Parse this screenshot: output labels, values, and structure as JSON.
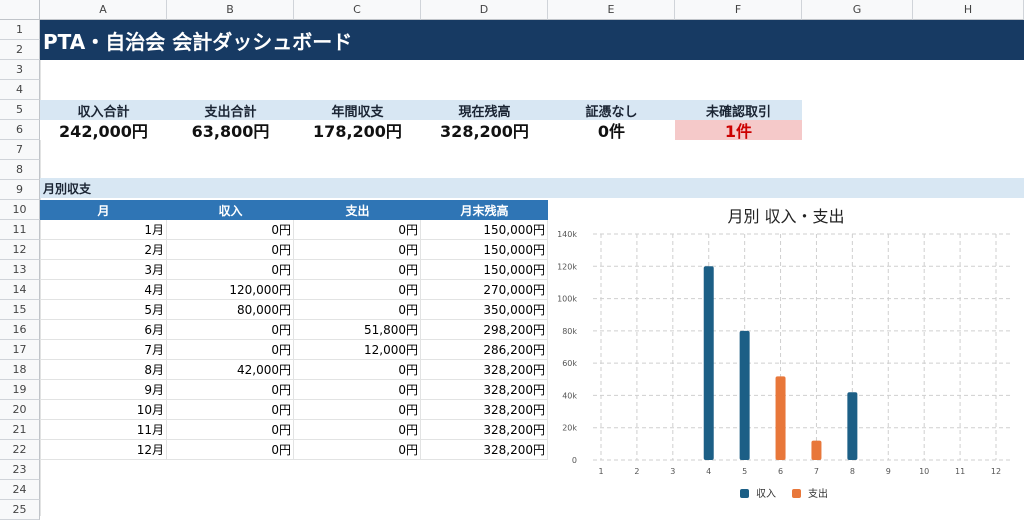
{
  "columns": [
    "A",
    "B",
    "C",
    "D",
    "E",
    "F",
    "G",
    "H"
  ],
  "rows": [
    "1",
    "2",
    "3",
    "4",
    "5",
    "6",
    "7",
    "8",
    "9",
    "10",
    "11",
    "12",
    "13",
    "14",
    "15",
    "16",
    "17",
    "18",
    "19",
    "20",
    "21",
    "22",
    "23",
    "24",
    "25"
  ],
  "title": "PTA・自治会 会計ダッシュボード",
  "kpis": [
    {
      "label": "収入合計",
      "value": "242,000円"
    },
    {
      "label": "支出合計",
      "value": "63,800円"
    },
    {
      "label": "年間収支",
      "value": "178,200円"
    },
    {
      "label": "現在残高",
      "value": "328,200円"
    },
    {
      "label": "証憑なし",
      "value": "0件"
    },
    {
      "label": "未確認取引",
      "value": "1件"
    }
  ],
  "section_title": "月別収支",
  "table": {
    "headers": [
      "月",
      "収入",
      "支出",
      "月末残高"
    ],
    "rows": [
      [
        "1月",
        "0円",
        "0円",
        "150,000円"
      ],
      [
        "2月",
        "0円",
        "0円",
        "150,000円"
      ],
      [
        "3月",
        "0円",
        "0円",
        "150,000円"
      ],
      [
        "4月",
        "120,000円",
        "0円",
        "270,000円"
      ],
      [
        "5月",
        "80,000円",
        "0円",
        "350,000円"
      ],
      [
        "6月",
        "0円",
        "51,800円",
        "298,200円"
      ],
      [
        "7月",
        "0円",
        "12,000円",
        "286,200円"
      ],
      [
        "8月",
        "42,000円",
        "0円",
        "328,200円"
      ],
      [
        "9月",
        "0円",
        "0円",
        "328,200円"
      ],
      [
        "10月",
        "0円",
        "0円",
        "328,200円"
      ],
      [
        "11月",
        "0円",
        "0円",
        "328,200円"
      ],
      [
        "12月",
        "0円",
        "0円",
        "328,200円"
      ]
    ]
  },
  "colors": {
    "title_bg": "#173a63",
    "header_bg": "#2f75b5",
    "label_bg": "#d8e7f3",
    "warn_bg": "#f5c9c9",
    "warn_text": "#cc0000",
    "income": "#1c5f86",
    "expense": "#e8773a"
  },
  "chart_data": {
    "type": "bar",
    "title": "月別 収入・支出",
    "categories": [
      "1",
      "2",
      "3",
      "4",
      "5",
      "6",
      "7",
      "8",
      "9",
      "10",
      "11",
      "12"
    ],
    "series": [
      {
        "name": "収入",
        "values": [
          0,
          0,
          0,
          120000,
          80000,
          0,
          0,
          42000,
          0,
          0,
          0,
          0
        ]
      },
      {
        "name": "支出",
        "values": [
          0,
          0,
          0,
          0,
          0,
          51800,
          12000,
          0,
          0,
          0,
          0,
          0
        ]
      }
    ],
    "ylim": [
      0,
      140000
    ],
    "yticks": [
      "0",
      "20k",
      "40k",
      "60k",
      "80k",
      "100k",
      "120k",
      "140k"
    ],
    "grid": true,
    "legend": "bottom"
  }
}
